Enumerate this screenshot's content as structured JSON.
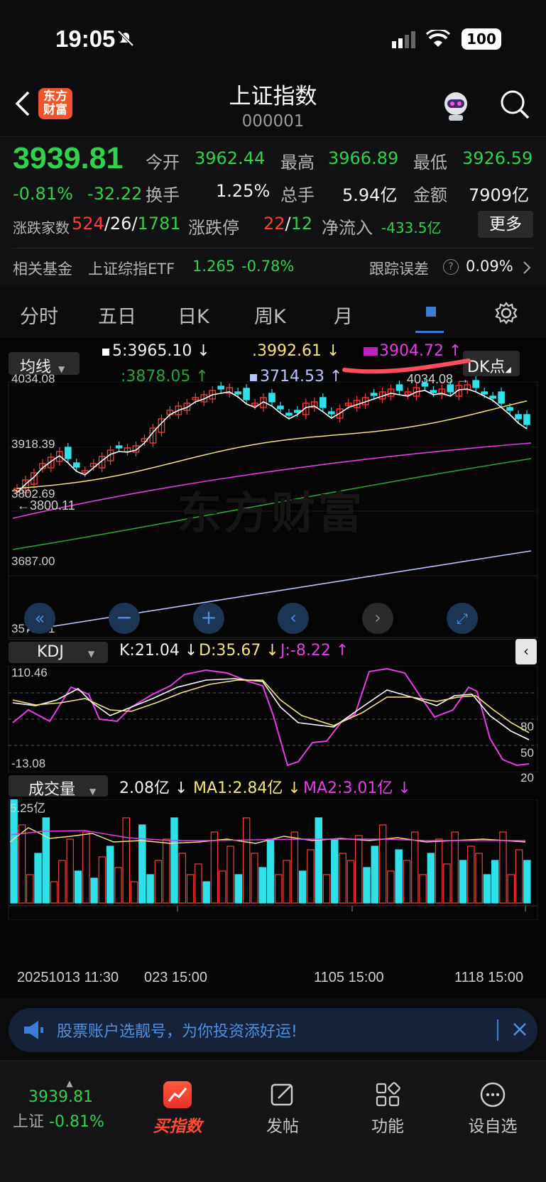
{
  "status": {
    "time": "19:05",
    "battery": "100"
  },
  "nav": {
    "title": "上证指数",
    "code": "000001",
    "logo_text": "东方\n财富"
  },
  "quote": {
    "price": "3939.81",
    "change_pct": "-0.81%",
    "change": "-32.22",
    "open_label": "今开",
    "open": "3962.44",
    "high_label": "最高",
    "high": "3966.89",
    "low_label": "最低",
    "low": "3926.59",
    "turnover_label": "换手",
    "turnover": "1.25%",
    "volume_label": "总手",
    "volume": "5.94亿",
    "amount_label": "金额",
    "amount": "7909亿",
    "breadth_label": "涨跌家数",
    "up": "524",
    "flat": "26",
    "down": "1781",
    "limit_label": "涨跌停",
    "limit_up": "22",
    "limit_down": "12",
    "netflow_label": "净流入",
    "netflow": "-433.5亿",
    "more_button": "更多"
  },
  "fund": {
    "label": "相关基金",
    "name": "上证综指ETF",
    "price": "1.265",
    "change": "-0.78%",
    "error_label": "跟踪误差",
    "error_value": "0.09%"
  },
  "tabs": [
    "分时",
    "五日",
    "日K",
    "周K",
    "月"
  ],
  "chart": {
    "ma_selector": "均线",
    "ma5": "5:3965.10",
    "ma10": ".3992.61",
    "ma20": "3904.72",
    "ma30": ":3878.05",
    "ma60": "3714.53",
    "dk_button": "DK点",
    "price_ticks": [
      "4034.08",
      "3918.39",
      "3802.69",
      "3687.00",
      "3571.31"
    ],
    "high_marker": "4034.08",
    "low_marker": "3800.11",
    "watermark": "东方财富",
    "kdj_selector": "KDJ",
    "kdj_k": "K:21.04",
    "kdj_d": "D:35.67",
    "kdj_j": "J:-8.22",
    "kdj_ticks_left": [
      "110.46",
      "-13.08"
    ],
    "kdj_ticks_right": [
      "80",
      "50",
      "20"
    ],
    "vol_selector": "成交量",
    "vol_value": "2.08亿",
    "vol_ma1": "MA1:2.84亿",
    "vol_ma2": "MA2:3.01亿",
    "vol_max": "5.25亿",
    "dates": [
      "20251013 11:30",
      "023 15:00",
      "1105 15:00",
      "1118 15:00"
    ],
    "colors": {
      "up": "#ff3b3b",
      "down": "#2ee0e8",
      "ma5": "#ffffff",
      "ma10": "#f5e47a",
      "ma20": "#e83ce8",
      "ma30": "#1fa83a",
      "ma60": "#b8c4ff"
    }
  },
  "ad": {
    "text": "股票账户选靓号，为你投资添好运!"
  },
  "bottom_nav": {
    "index_price": "3939.81",
    "index_name": "上证",
    "index_change": "-0.81%",
    "items": [
      "买指数",
      "发帖",
      "功能",
      "设自选"
    ]
  }
}
